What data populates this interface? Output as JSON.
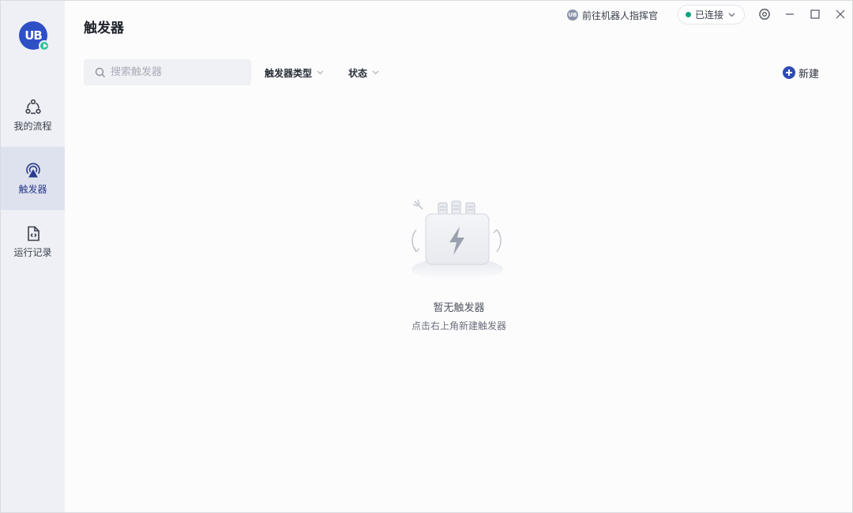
{
  "app": {
    "logo_text": "UB"
  },
  "sidebar": {
    "items": [
      {
        "label": "我的流程",
        "icon": "flow-icon",
        "active": false
      },
      {
        "label": "触发器",
        "icon": "trigger-icon",
        "active": true
      },
      {
        "label": "运行记录",
        "icon": "record-icon",
        "active": false
      }
    ]
  },
  "header": {
    "title": "触发器",
    "commander_link": "前往机器人指挥官",
    "connection_status": "已连接",
    "status_color": "#16a085"
  },
  "toolbar": {
    "search_placeholder": "搜索触发器",
    "filter_type_label": "触发器类型",
    "filter_status_label": "状态",
    "new_label": "新建"
  },
  "empty_state": {
    "title": "暂无触发器",
    "hint": "点击右上角新建触发器"
  },
  "colors": {
    "accent": "#2f4bb4",
    "sidebar_bg": "#eef0f5",
    "sidebar_active_bg": "#dde2ee"
  }
}
